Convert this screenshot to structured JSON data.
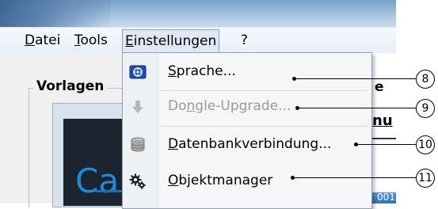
{
  "menubar": {
    "items": [
      {
        "label": "Datei",
        "mnemonic": "D",
        "rest": "atei"
      },
      {
        "label": "Tools",
        "mnemonic": "T",
        "rest": "ools"
      },
      {
        "label": "Einstellungen",
        "mnemonic": "E",
        "rest": "instellungen"
      },
      {
        "label": "?"
      }
    ]
  },
  "app": {
    "vorlagen_label": "Vorlagen",
    "preview_text": "Ca",
    "right_fragment_e": "e",
    "right_fragment_mu": "nu",
    "right_fragment_num": "001"
  },
  "dropdown": {
    "items": [
      {
        "label": "Sprache...",
        "pre": "",
        "mnemonic": "S",
        "post": "prache...",
        "icon": "language-icon",
        "disabled": false,
        "callout": "8"
      },
      {
        "label": "Dongle-Upgrade...",
        "pre": "Do",
        "mnemonic": "n",
        "post": "gle-Upgrade...",
        "icon": "download-arrow-icon",
        "disabled": true,
        "callout": "9"
      },
      {
        "label": "Datenbankverbindung...",
        "pre": "",
        "mnemonic": "D",
        "post": "atenbankverbindung...",
        "icon": "database-icon",
        "disabled": false,
        "callout": "10"
      },
      {
        "label": "Objektmanager",
        "pre": "",
        "mnemonic": "O",
        "post": "bjektmanager",
        "icon": "gears-icon",
        "disabled": false,
        "callout": "11"
      }
    ]
  },
  "colors": {
    "menu_open_bg": "#dfe8f4",
    "menu_border": "#8da2bd",
    "disabled_text": "#9a9a9a"
  }
}
